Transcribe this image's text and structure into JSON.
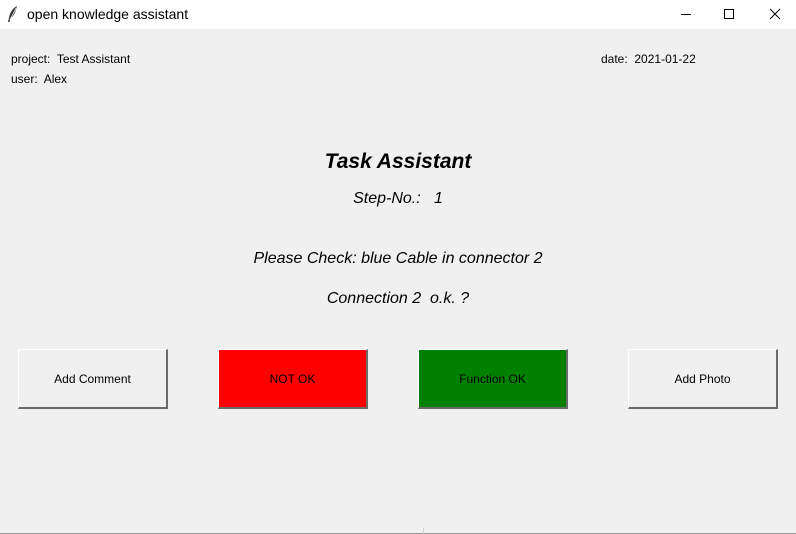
{
  "window": {
    "title": "open knowledge assistant",
    "icon": "feather-icon",
    "controls": [
      "minimize-icon",
      "maximize-icon",
      "close-icon"
    ]
  },
  "info": {
    "project_label": "project:",
    "project_value": "Test Assistant",
    "user_label": "user:",
    "user_value": "Alex",
    "date_label": "date:",
    "date_value": "2021-01-22"
  },
  "main": {
    "heading": "Task Assistant",
    "step_label": "Step-No.:",
    "step_value": "1",
    "instruction": "Please Check: blue Cable in connector 2",
    "question": "Connection 2  o.k. ?"
  },
  "buttons": {
    "add_comment": "Add Comment",
    "not_ok": "NOT OK",
    "function_ok": "Function OK",
    "add_photo": "Add Photo"
  },
  "colors": {
    "background": "#f0f0f0",
    "not_ok": "#ff0000",
    "function_ok": "#008000"
  }
}
